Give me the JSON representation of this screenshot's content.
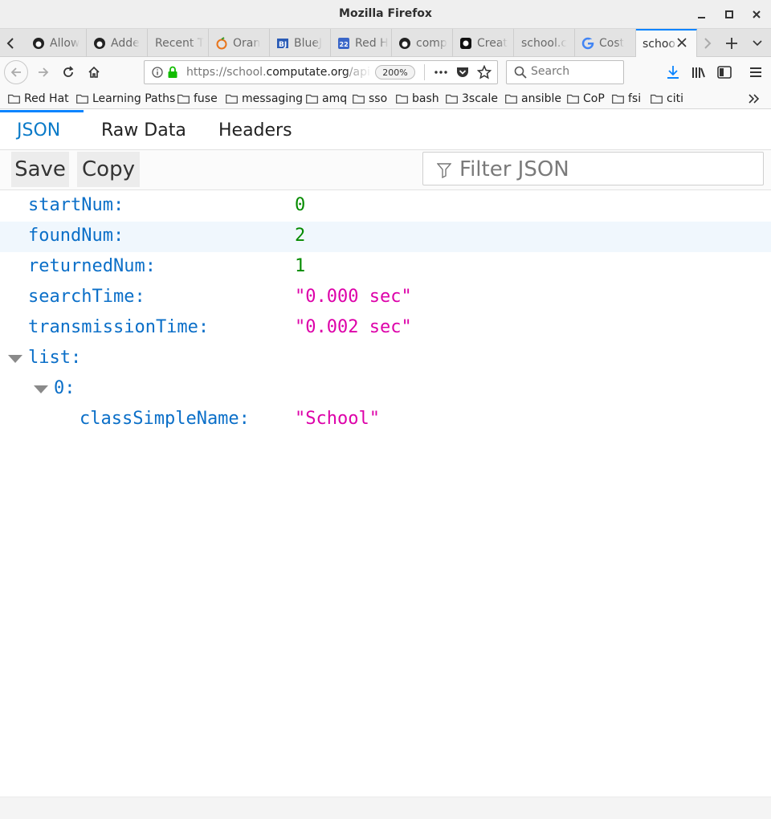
{
  "window": {
    "title": "Mozilla Firefox"
  },
  "tabs": [
    {
      "label": "Allow",
      "icon": "github-icon"
    },
    {
      "label": "Adde",
      "icon": "github-icon"
    },
    {
      "label": "Recent T",
      "icon": ""
    },
    {
      "label": "Oran",
      "icon": "orange-icon"
    },
    {
      "label": "BlueJ",
      "icon": "bluej-icon"
    },
    {
      "label": "Red H",
      "icon": "calendar-icon"
    },
    {
      "label": "comp",
      "icon": "github-icon"
    },
    {
      "label": "Creat",
      "icon": "app-icon"
    },
    {
      "label": "school.c",
      "icon": ""
    },
    {
      "label": "Cost",
      "icon": "google-icon"
    },
    {
      "label": "schoo",
      "icon": ""
    }
  ],
  "navbar": {
    "url_prefix": "https://school.",
    "url_domain": "computate.org",
    "url_suffix": "/api",
    "zoom": "200%",
    "search_placeholder": "Search"
  },
  "bookmarks": [
    "Red Hat",
    "Learning Paths",
    "fuse",
    "messaging",
    "amq",
    "sso",
    "bash",
    "3scale",
    "ansible",
    "CoP",
    "fsi",
    "citi"
  ],
  "viewer": {
    "tabs": {
      "json": "JSON",
      "raw": "Raw Data",
      "headers": "Headers"
    },
    "save_label": "Save",
    "copy_label": "Copy",
    "filter_placeholder": "Filter JSON"
  },
  "json": {
    "startNum": {
      "key": "startNum:",
      "value": "0"
    },
    "foundNum": {
      "key": "foundNum:",
      "value": "2"
    },
    "returnedNum": {
      "key": "returnedNum:",
      "value": "1"
    },
    "searchTime": {
      "key": "searchTime:",
      "value": "\"0.000 sec\""
    },
    "transmissionTime": {
      "key": "transmissionTime:",
      "value": "\"0.002 sec\""
    },
    "list": {
      "key": "list:"
    },
    "item0": {
      "key": "0:"
    },
    "classSimpleName": {
      "key": "classSimpleName:",
      "value": "\"School\""
    }
  },
  "colors": {
    "accent": "#0a84ff",
    "key": "#0b6fc8",
    "number": "#058b00",
    "string": "#dd00a9"
  }
}
